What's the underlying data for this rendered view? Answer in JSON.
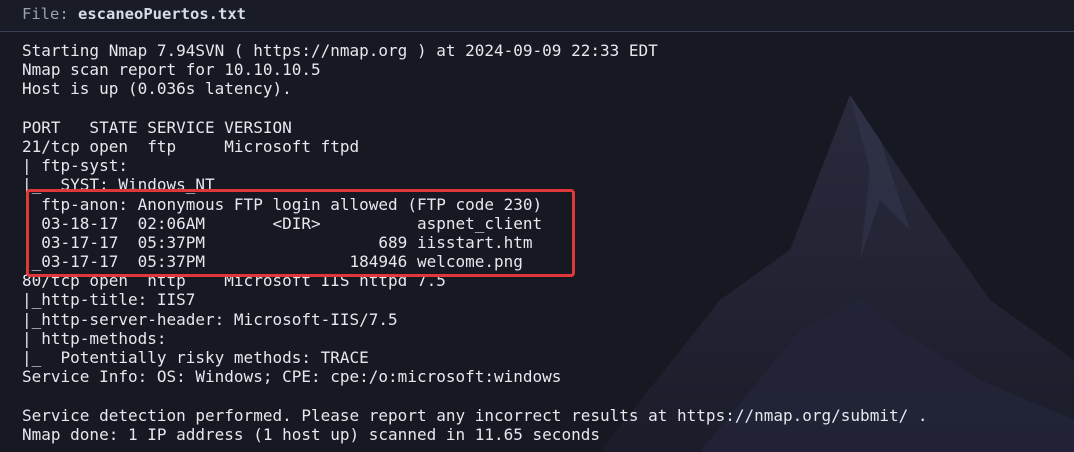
{
  "header": {
    "label": "File:",
    "filename": "escaneoPuertos.txt"
  },
  "colors": {
    "background": "#161822",
    "text": "#e6e8ef",
    "highlight_border": "#e0373b",
    "header_label": "#9aa0b4"
  },
  "output_lines": [
    "Starting Nmap 7.94SVN ( https://nmap.org ) at 2024-09-09 22:33 EDT",
    "Nmap scan report for 10.10.10.5",
    "Host is up (0.036s latency).",
    "",
    "PORT   STATE SERVICE VERSION",
    "21/tcp open  ftp     Microsoft ftpd",
    "| ftp-syst:",
    "|_  SYST: Windows_NT",
    "| ftp-anon: Anonymous FTP login allowed (FTP code 230)",
    "| 03-18-17  02:06AM       <DIR>          aspnet_client",
    "| 03-17-17  05:37PM                  689 iisstart.htm",
    "|_03-17-17  05:37PM               184946 welcome.png",
    "80/tcp open  http    Microsoft IIS httpd 7.5",
    "|_http-title: IIS7",
    "|_http-server-header: Microsoft-IIS/7.5",
    "| http-methods:",
    "|_  Potentially risky methods: TRACE",
    "Service Info: OS: Windows; CPE: cpe:/o:microsoft:windows",
    "",
    "Service detection performed. Please report any incorrect results at https://nmap.org/submit/ .",
    "Nmap done: 1 IP address (1 host up) scanned in 11.65 seconds"
  ]
}
